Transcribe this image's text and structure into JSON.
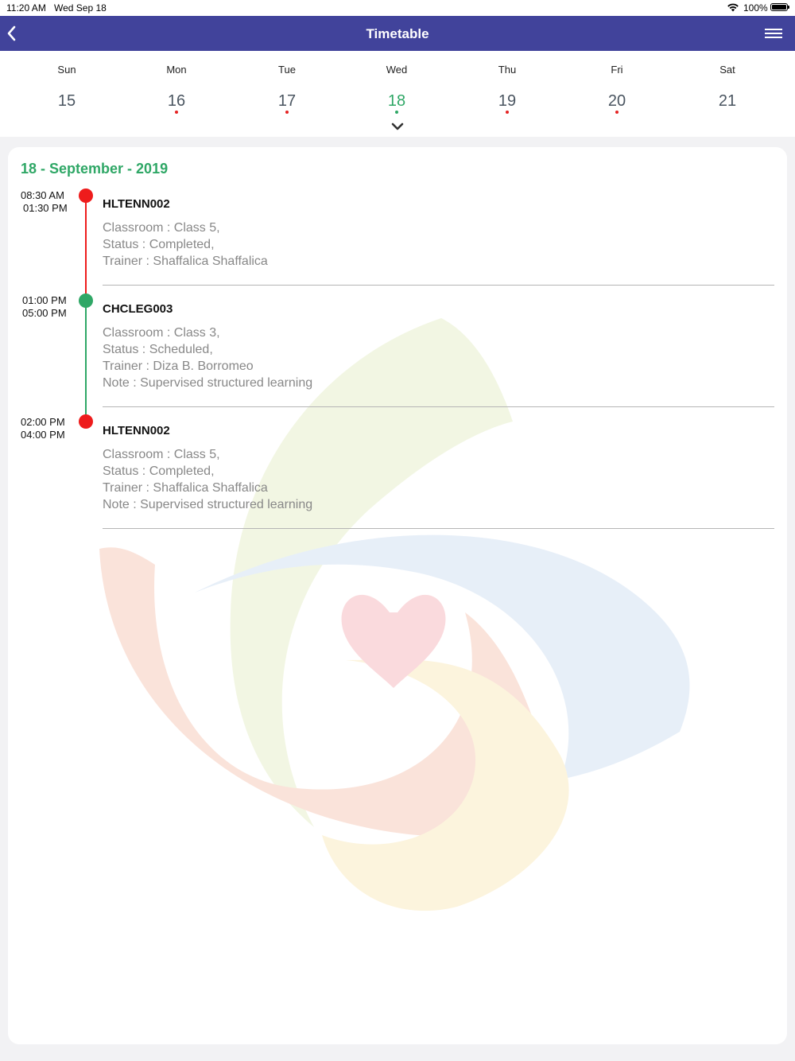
{
  "status_bar": {
    "time": "11:20 AM",
    "date": "Wed Sep 18",
    "battery": "100%"
  },
  "nav": {
    "title": "Timetable",
    "back_icon": "chevron-left-icon",
    "menu_icon": "hamburger-menu-icon"
  },
  "colors": {
    "nav_bg": "#41439b",
    "selected_green": "#2fa766",
    "completed_red": "#ee1c1c",
    "scheduled_green": "#2fa766"
  },
  "week": {
    "days": [
      {
        "name": "Sun",
        "num": "15",
        "dot": false
      },
      {
        "name": "Mon",
        "num": "16",
        "dot": true,
        "dot_color": "#e52222"
      },
      {
        "name": "Tue",
        "num": "17",
        "dot": true,
        "dot_color": "#e52222"
      },
      {
        "name": "Wed",
        "num": "18",
        "dot": true,
        "dot_color": "#2fa766",
        "selected": true
      },
      {
        "name": "Thu",
        "num": "19",
        "dot": true,
        "dot_color": "#e52222"
      },
      {
        "name": "Fri",
        "num": "20",
        "dot": true,
        "dot_color": "#e52222"
      },
      {
        "name": "Sat",
        "num": "21",
        "dot": false
      }
    ]
  },
  "timetable": {
    "date_heading": "18 - September - 2019",
    "events": [
      {
        "start": "08:30 AM",
        "end": "01:30 PM",
        "code": "HLTENN002",
        "status_color": "#ee1c1c",
        "lines": [
          "Classroom : Class 5,",
          "Status : Completed,",
          "Trainer : Shaffalica Shaffalica"
        ]
      },
      {
        "start": "01:00 PM",
        "end": "05:00 PM",
        "code": "CHCLEG003",
        "status_color": "#2fa766",
        "lines": [
          "Classroom : Class 3,",
          "Status : Scheduled,",
          "Trainer : Diza B. Borromeo",
          "Note : Supervised structured learning"
        ]
      },
      {
        "start": "02:00 PM",
        "end": "04:00 PM",
        "code": "HLTENN002",
        "status_color": "#ee1c1c",
        "lines": [
          "Classroom : Class 5,",
          "Status : Completed,",
          "Trainer : Shaffalica Shaffalica",
          "Note : Supervised structured learning"
        ]
      }
    ]
  }
}
